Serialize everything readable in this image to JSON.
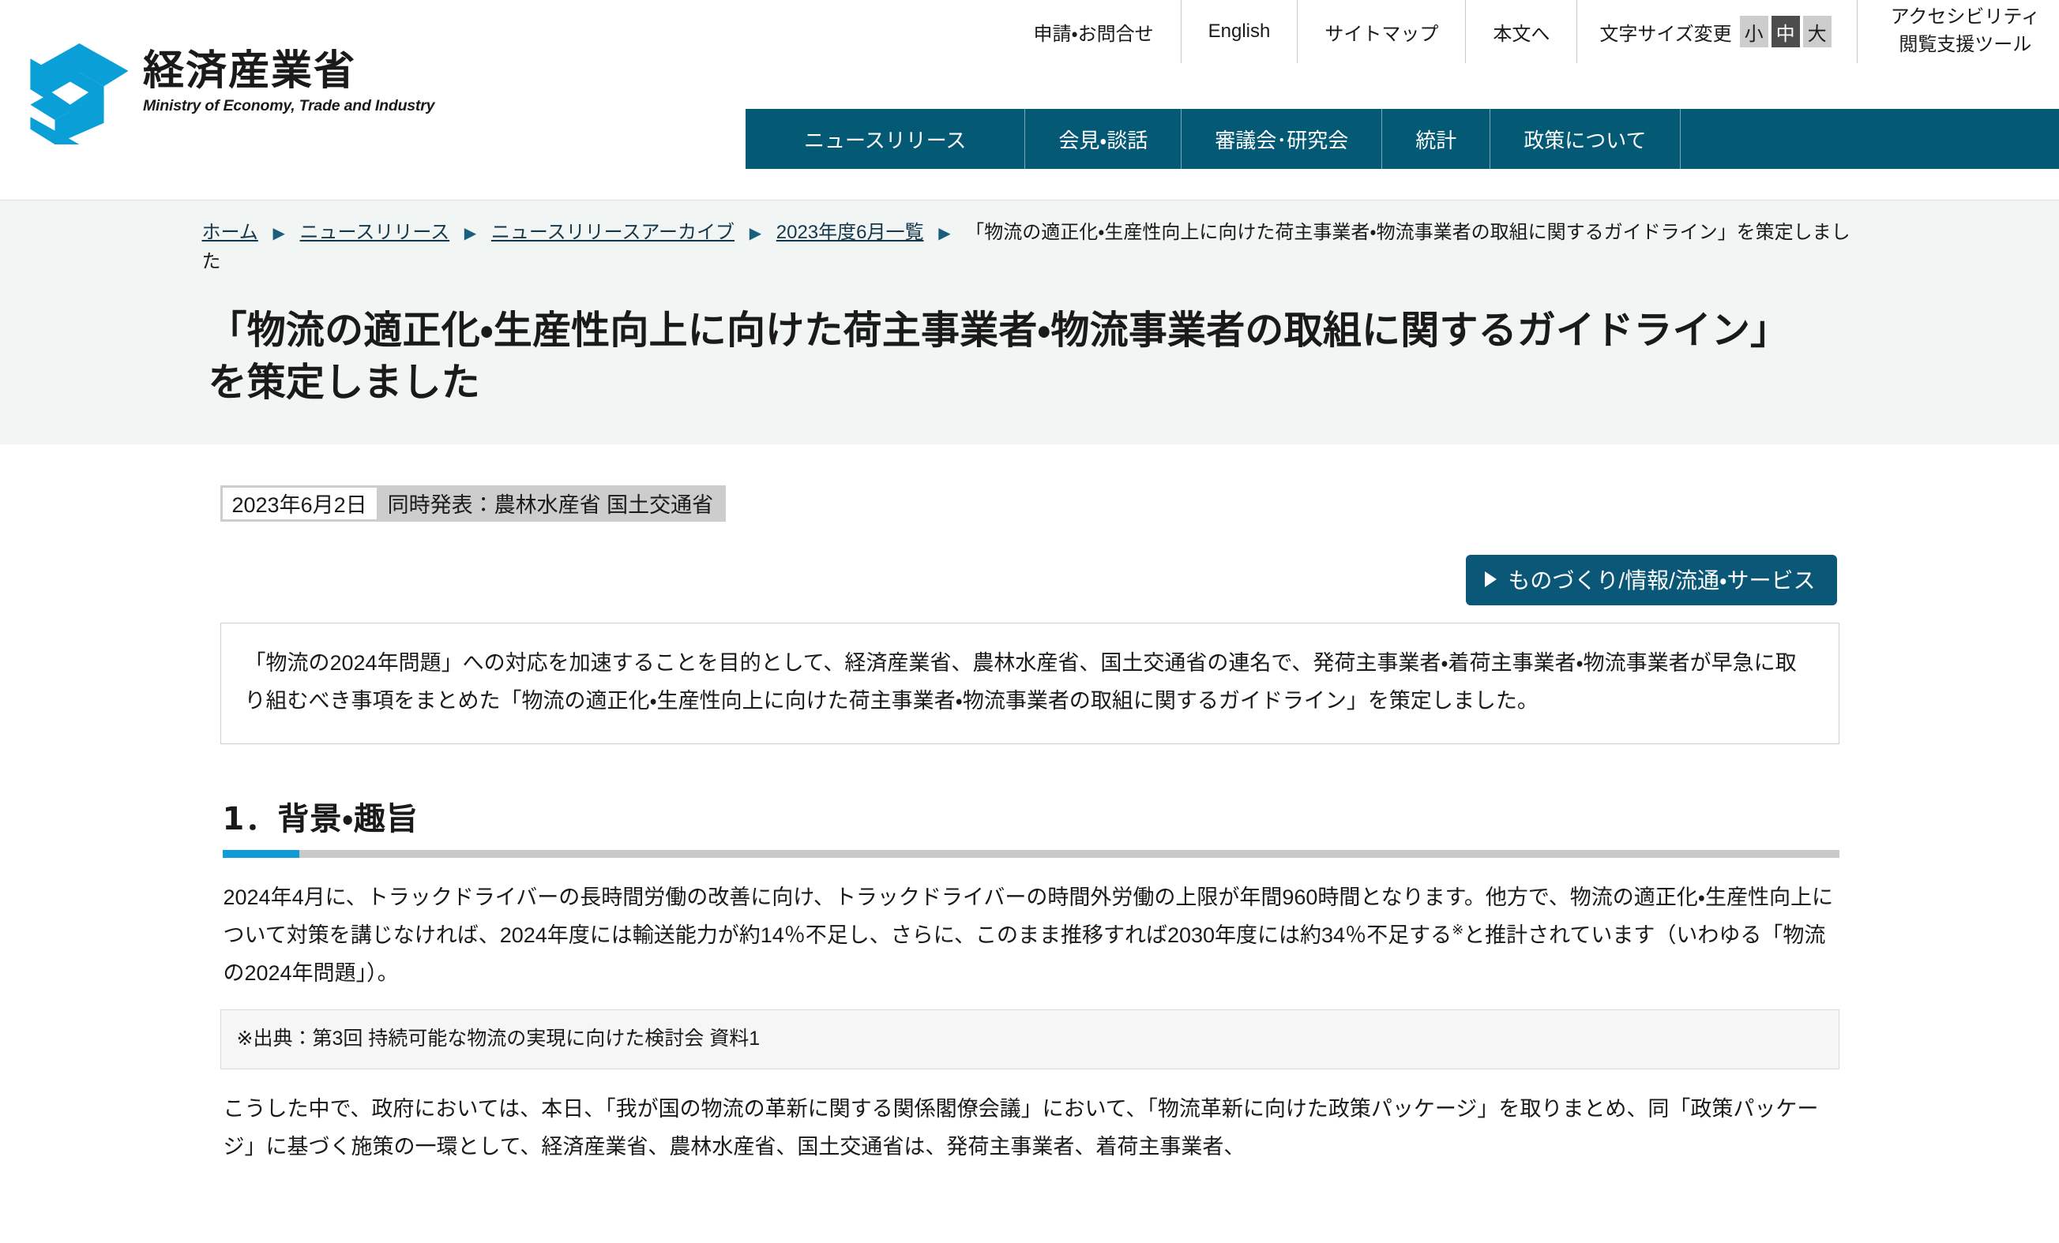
{
  "header": {
    "logo": {
      "jp": "経済産業省",
      "en": "Ministry of Economy, Trade and Industry",
      "mark_color": "#0b9fd8"
    },
    "utility_links": [
      {
        "label": "申請・お問合せ"
      },
      {
        "label": "English"
      },
      {
        "label": "サイトマップ"
      },
      {
        "label": "本文へ"
      }
    ],
    "font_size": {
      "label": "文字サイズ変更",
      "options": [
        {
          "label": "小",
          "active": false
        },
        {
          "label": "中",
          "active": true
        },
        {
          "label": "大",
          "active": false
        }
      ]
    },
    "accessibility": {
      "line1": "アクセシビリティ",
      "line2": "閲覧支援ツール"
    },
    "global_nav": {
      "background": "#045975",
      "items": [
        {
          "label": "ニュースリリース"
        },
        {
          "label": "会見・談話"
        },
        {
          "label": "審議会･研究会"
        },
        {
          "label": "統計"
        },
        {
          "label": "政策について"
        }
      ]
    }
  },
  "breadcrumb": {
    "links": [
      "ホーム",
      "ニュースリリース",
      "ニュースリリースアーカイブ",
      "2023年度6月一覧"
    ],
    "separator": "▶",
    "current": "「物流の適正化・生産性向上に向けた荷主事業者・物流事業者の取組に関するガイドライン」を策定しました"
  },
  "page_title": "「物流の適正化・生産性向上に向けた荷主事業者・物流事業者の取組に関するガイドライン」を策定しました",
  "meta": {
    "date": "2023年6月2日",
    "co_announcement": "同時発表：農林水産省 国土交通省"
  },
  "category_button": {
    "label": "ものづくり/情報/流通・サービス",
    "color": "#0b5777"
  },
  "summary": "「物流の2024年問題」への対応を加速することを目的として、経済産業省、農林水産省、国土交通省の連名で、発荷主事業者・着荷主事業者・物流事業者が早急に取り組むべき事項をまとめた「物流の適正化・生産性向上に向けた荷主事業者・物流事業者の取組に関するガイドライン」を策定しました。",
  "sections": [
    {
      "heading": "1．背景・趣旨",
      "accent_color": "#0f9bd7",
      "paragraph_1_a": "2024年4月に、トラックドライバーの長時間労働の改善に向け、トラックドライバーの時間外労働の上限が年間960時間となります。他方で、物流の適正化・生産性向上について対策を講じなければ、2024年度には輸送能力が約14％不足し、さらに、このまま推移すれば2030年度には約34％不足する",
      "paragraph_1_sup": "※",
      "paragraph_1_b": "と推計されています（いわゆる「物流の2024年問題」）。",
      "note": "※出典：第3回 持続可能な物流の実現に向けた検討会 資料1",
      "paragraph_2": "こうした中で、政府においては、本日、「我が国の物流の革新に関する関係閣僚会議」において、「物流革新に向けた政策パッケージ」を取りまとめ、同「政策パッケージ」に基づく施策の一環として、経済産業省、農林水産省、国土交通省は、発荷主事業者、着荷主事業者、"
    }
  ]
}
